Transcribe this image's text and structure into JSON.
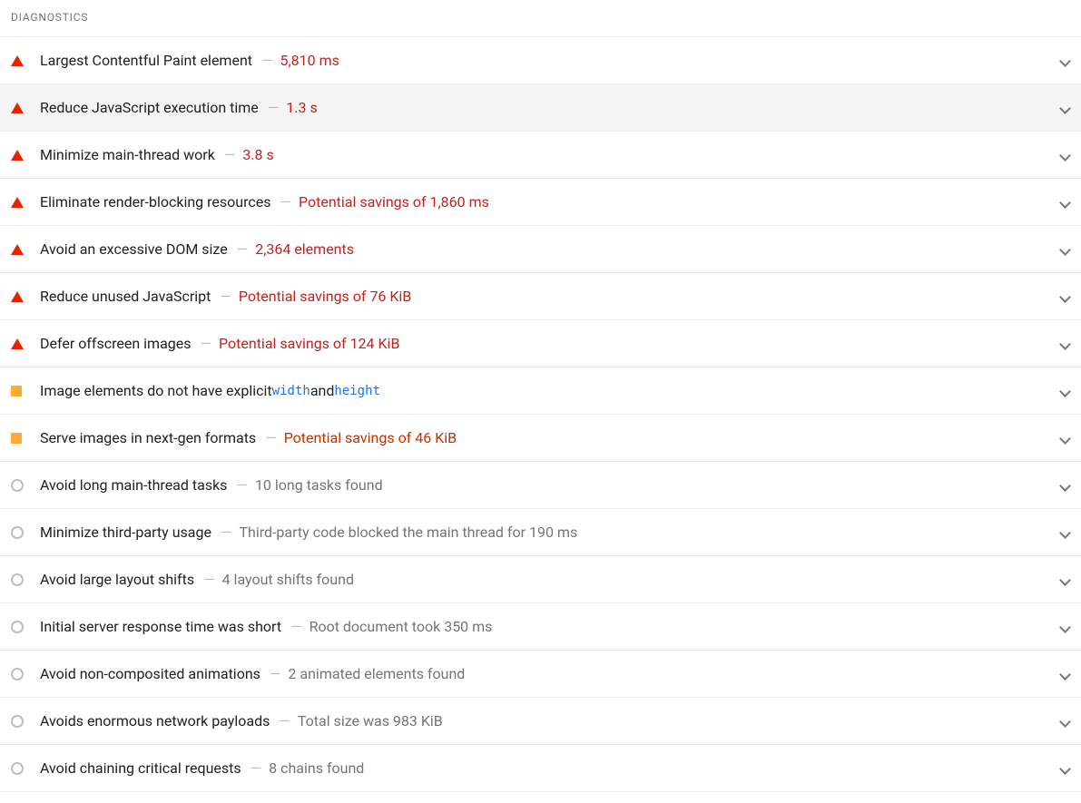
{
  "section": {
    "header": "DIAGNOSTICS"
  },
  "audits": [
    {
      "severity": "fail",
      "title": "Largest Contentful Paint element",
      "metric": "5,810 ms",
      "metricStyle": "fail",
      "highlight": false
    },
    {
      "severity": "fail",
      "title": "Reduce JavaScript execution time",
      "metric": "1.3 s",
      "metricStyle": "fail",
      "highlight": true
    },
    {
      "severity": "fail",
      "title": "Minimize main-thread work",
      "metric": "3.8 s",
      "metricStyle": "fail",
      "highlight": false
    },
    {
      "severity": "fail",
      "title": "Eliminate render-blocking resources",
      "metric": "Potential savings of 1,860 ms",
      "metricStyle": "fail",
      "highlight": false
    },
    {
      "severity": "fail",
      "title": "Avoid an excessive DOM size",
      "metric": "2,364 elements",
      "metricStyle": "fail",
      "highlight": false
    },
    {
      "severity": "fail",
      "title": "Reduce unused JavaScript",
      "metric": "Potential savings of 76 KiB",
      "metricStyle": "fail",
      "highlight": false
    },
    {
      "severity": "fail",
      "title": "Defer offscreen images",
      "metric": "Potential savings of 124 KiB",
      "metricStyle": "fail",
      "highlight": false
    },
    {
      "severity": "avg",
      "title_parts": [
        "Image elements do not have explicit ",
        {
          "code": "width"
        },
        " and ",
        {
          "code": "height"
        }
      ],
      "metric": null,
      "highlight": false
    },
    {
      "severity": "avg",
      "title": "Serve images in next-gen formats",
      "metric": "Potential savings of 46 KiB",
      "metricStyle": "avg",
      "highlight": false
    },
    {
      "severity": "info",
      "title": "Avoid long main-thread tasks",
      "metric": "10 long tasks found",
      "metricStyle": "gray",
      "highlight": false
    },
    {
      "severity": "info",
      "title": "Minimize third-party usage",
      "metric": "Third-party code blocked the main thread for 190 ms",
      "metricStyle": "gray",
      "highlight": false
    },
    {
      "severity": "info",
      "title": "Avoid large layout shifts",
      "metric": "4 layout shifts found",
      "metricStyle": "gray",
      "highlight": false
    },
    {
      "severity": "info",
      "title": "Initial server response time was short",
      "metric": "Root document took 350 ms",
      "metricStyle": "gray",
      "highlight": false
    },
    {
      "severity": "info",
      "title": "Avoid non-composited animations",
      "metric": "2 animated elements found",
      "metricStyle": "gray",
      "highlight": false
    },
    {
      "severity": "info",
      "title": "Avoids enormous network payloads",
      "metric": "Total size was 983 KiB",
      "metricStyle": "gray",
      "highlight": false
    },
    {
      "severity": "info",
      "title": "Avoid chaining critical requests",
      "metric": "8 chains found",
      "metricStyle": "gray",
      "highlight": false
    }
  ],
  "icons": {
    "fail_name": "triangle-fail-icon",
    "avg_name": "square-average-icon",
    "info_name": "circle-info-icon",
    "chevron_name": "chevron-down-icon"
  }
}
